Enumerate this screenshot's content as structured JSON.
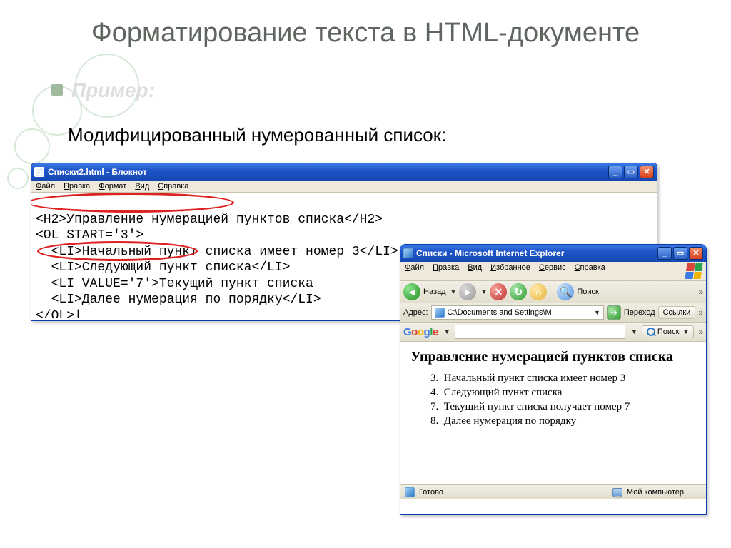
{
  "slide": {
    "title": "Форматирование текста в HTML-документе",
    "example_label": "Пример:",
    "subhead": "Модифицированный нумерованный список:"
  },
  "notepad": {
    "title": "Списки2.html - Блокнот",
    "menu": {
      "file": "Файл",
      "edit": "Правка",
      "format": "Формат",
      "view": "Вид",
      "help": "Справка"
    },
    "code_lines": [
      "<H2>Управление нумерацией пунктов списка</H2>",
      "<OL START='3'>",
      "  <LI>Начальный пункт списка имеет номер 3</LI>",
      "  <LI>Следующий пункт списка</LI>",
      "  <LI VALUE='7'>Текущий пункт списка",
      "  <LI>Далее нумерация по порядку</LI>",
      "</OL>|"
    ]
  },
  "ie": {
    "title": "Списки - Microsoft Internet Explorer",
    "menu": {
      "file": "Файл",
      "edit": "Правка",
      "view": "Вид",
      "favorites": "Избранное",
      "tools": "Сервис",
      "help": "Справка"
    },
    "toolbar": {
      "back": "Назад",
      "search": "Поиск"
    },
    "address_label": "Адрес:",
    "address_value": "C:\\Documents and Settings\\M",
    "go_label": "Переход",
    "links_label": "Ссылки",
    "google_search": "Поиск",
    "status_ready": "Готово",
    "status_zone": "Мой компьютер",
    "content": {
      "heading": "Управление нумерацией пунктов списка",
      "items": [
        {
          "n": "3.",
          "t": "Начальный пункт списка имеет номер 3"
        },
        {
          "n": "4.",
          "t": "Следующий пункт списка"
        },
        {
          "n": "7.",
          "t": "Текущий пункт списка получает номер 7"
        },
        {
          "n": "8.",
          "t": "Далее нумерация по порядку"
        }
      ]
    }
  }
}
